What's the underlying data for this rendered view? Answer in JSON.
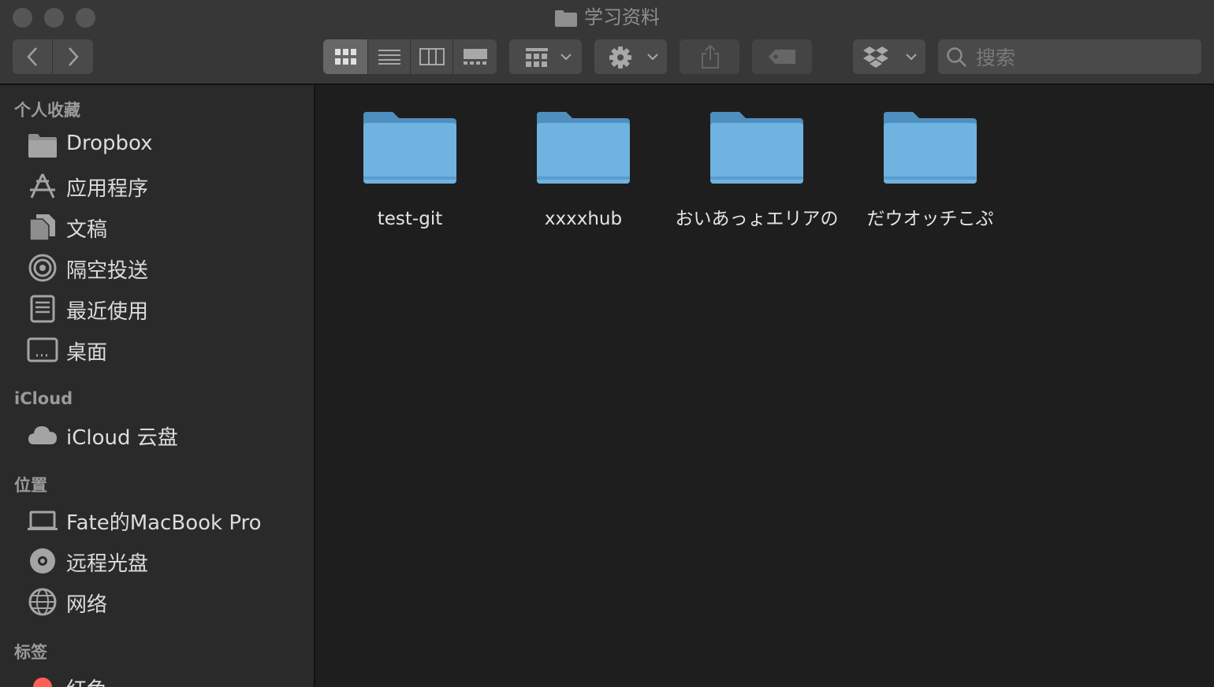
{
  "window": {
    "title": "学习资料"
  },
  "toolbar": {
    "back_icon": "chevron-left-icon",
    "forward_icon": "chevron-right-icon",
    "view_modes": [
      "icon-view",
      "list-view",
      "column-view",
      "gallery-view"
    ],
    "active_view": "icon-view",
    "group_icon": "group-grid-icon",
    "action_icon": "gear-icon",
    "share_icon": "share-icon",
    "tag_icon": "tag-icon",
    "dropbox_icon": "dropbox-icon"
  },
  "search": {
    "placeholder": "搜索"
  },
  "sidebar": {
    "favorites_title": "个人收藏",
    "favorites": [
      {
        "label": "Dropbox",
        "icon": "folder-icon"
      },
      {
        "label": "应用程序",
        "icon": "applications-icon"
      },
      {
        "label": "文稿",
        "icon": "documents-icon"
      },
      {
        "label": "隔空投送",
        "icon": "airdrop-icon"
      },
      {
        "label": "最近使用",
        "icon": "recents-icon"
      },
      {
        "label": "桌面",
        "icon": "desktop-icon"
      }
    ],
    "icloud_title": "iCloud",
    "icloud": [
      {
        "label": "iCloud 云盘",
        "icon": "cloud-icon"
      }
    ],
    "locations_title": "位置",
    "locations": [
      {
        "label": "Fate的MacBook Pro",
        "icon": "laptop-icon"
      },
      {
        "label": "远程光盘",
        "icon": "disc-icon"
      },
      {
        "label": "网络",
        "icon": "globe-icon"
      }
    ],
    "tags_title": "标签",
    "tags": [
      {
        "label": "红色",
        "color": "#ff5f57"
      }
    ]
  },
  "files": [
    {
      "name": "test-git"
    },
    {
      "name": "xxxxhub"
    },
    {
      "name": "おいあっょエリアの"
    },
    {
      "name": "だウオッチこぷ"
    }
  ],
  "colors": {
    "folder_blue": "#6fb3e0",
    "folder_tab": "#4f8fbf",
    "background": "#1e1e1e",
    "sidebar": "#2a2a2a",
    "toolbar": "#373737"
  }
}
